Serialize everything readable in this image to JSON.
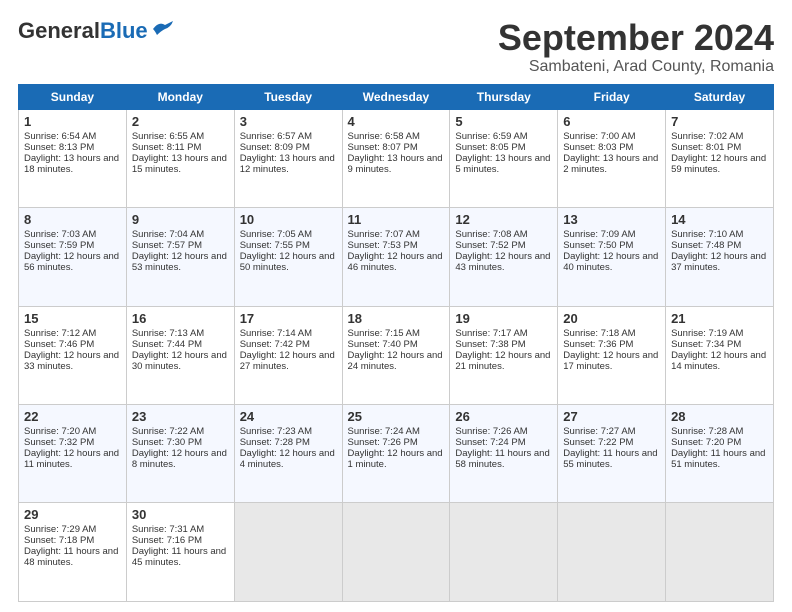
{
  "header": {
    "logo_general": "General",
    "logo_blue": "Blue",
    "main_title": "September 2024",
    "sub_title": "Sambateni, Arad County, Romania"
  },
  "weekdays": [
    "Sunday",
    "Monday",
    "Tuesday",
    "Wednesday",
    "Thursday",
    "Friday",
    "Saturday"
  ],
  "rows": [
    [
      {
        "day": "1",
        "info": "Sunrise: 6:54 AM\nSunset: 8:13 PM\nDaylight: 13 hours and 18 minutes."
      },
      {
        "day": "2",
        "info": "Sunrise: 6:55 AM\nSunset: 8:11 PM\nDaylight: 13 hours and 15 minutes."
      },
      {
        "day": "3",
        "info": "Sunrise: 6:57 AM\nSunset: 8:09 PM\nDaylight: 13 hours and 12 minutes."
      },
      {
        "day": "4",
        "info": "Sunrise: 6:58 AM\nSunset: 8:07 PM\nDaylight: 13 hours and 9 minutes."
      },
      {
        "day": "5",
        "info": "Sunrise: 6:59 AM\nSunset: 8:05 PM\nDaylight: 13 hours and 5 minutes."
      },
      {
        "day": "6",
        "info": "Sunrise: 7:00 AM\nSunset: 8:03 PM\nDaylight: 13 hours and 2 minutes."
      },
      {
        "day": "7",
        "info": "Sunrise: 7:02 AM\nSunset: 8:01 PM\nDaylight: 12 hours and 59 minutes."
      }
    ],
    [
      {
        "day": "8",
        "info": "Sunrise: 7:03 AM\nSunset: 7:59 PM\nDaylight: 12 hours and 56 minutes."
      },
      {
        "day": "9",
        "info": "Sunrise: 7:04 AM\nSunset: 7:57 PM\nDaylight: 12 hours and 53 minutes."
      },
      {
        "day": "10",
        "info": "Sunrise: 7:05 AM\nSunset: 7:55 PM\nDaylight: 12 hours and 50 minutes."
      },
      {
        "day": "11",
        "info": "Sunrise: 7:07 AM\nSunset: 7:53 PM\nDaylight: 12 hours and 46 minutes."
      },
      {
        "day": "12",
        "info": "Sunrise: 7:08 AM\nSunset: 7:52 PM\nDaylight: 12 hours and 43 minutes."
      },
      {
        "day": "13",
        "info": "Sunrise: 7:09 AM\nSunset: 7:50 PM\nDaylight: 12 hours and 40 minutes."
      },
      {
        "day": "14",
        "info": "Sunrise: 7:10 AM\nSunset: 7:48 PM\nDaylight: 12 hours and 37 minutes."
      }
    ],
    [
      {
        "day": "15",
        "info": "Sunrise: 7:12 AM\nSunset: 7:46 PM\nDaylight: 12 hours and 33 minutes."
      },
      {
        "day": "16",
        "info": "Sunrise: 7:13 AM\nSunset: 7:44 PM\nDaylight: 12 hours and 30 minutes."
      },
      {
        "day": "17",
        "info": "Sunrise: 7:14 AM\nSunset: 7:42 PM\nDaylight: 12 hours and 27 minutes."
      },
      {
        "day": "18",
        "info": "Sunrise: 7:15 AM\nSunset: 7:40 PM\nDaylight: 12 hours and 24 minutes."
      },
      {
        "day": "19",
        "info": "Sunrise: 7:17 AM\nSunset: 7:38 PM\nDaylight: 12 hours and 21 minutes."
      },
      {
        "day": "20",
        "info": "Sunrise: 7:18 AM\nSunset: 7:36 PM\nDaylight: 12 hours and 17 minutes."
      },
      {
        "day": "21",
        "info": "Sunrise: 7:19 AM\nSunset: 7:34 PM\nDaylight: 12 hours and 14 minutes."
      }
    ],
    [
      {
        "day": "22",
        "info": "Sunrise: 7:20 AM\nSunset: 7:32 PM\nDaylight: 12 hours and 11 minutes."
      },
      {
        "day": "23",
        "info": "Sunrise: 7:22 AM\nSunset: 7:30 PM\nDaylight: 12 hours and 8 minutes."
      },
      {
        "day": "24",
        "info": "Sunrise: 7:23 AM\nSunset: 7:28 PM\nDaylight: 12 hours and 4 minutes."
      },
      {
        "day": "25",
        "info": "Sunrise: 7:24 AM\nSunset: 7:26 PM\nDaylight: 12 hours and 1 minute."
      },
      {
        "day": "26",
        "info": "Sunrise: 7:26 AM\nSunset: 7:24 PM\nDaylight: 11 hours and 58 minutes."
      },
      {
        "day": "27",
        "info": "Sunrise: 7:27 AM\nSunset: 7:22 PM\nDaylight: 11 hours and 55 minutes."
      },
      {
        "day": "28",
        "info": "Sunrise: 7:28 AM\nSunset: 7:20 PM\nDaylight: 11 hours and 51 minutes."
      }
    ],
    [
      {
        "day": "29",
        "info": "Sunrise: 7:29 AM\nSunset: 7:18 PM\nDaylight: 11 hours and 48 minutes."
      },
      {
        "day": "30",
        "info": "Sunrise: 7:31 AM\nSunset: 7:16 PM\nDaylight: 11 hours and 45 minutes."
      },
      {
        "day": "",
        "info": ""
      },
      {
        "day": "",
        "info": ""
      },
      {
        "day": "",
        "info": ""
      },
      {
        "day": "",
        "info": ""
      },
      {
        "day": "",
        "info": ""
      }
    ]
  ]
}
